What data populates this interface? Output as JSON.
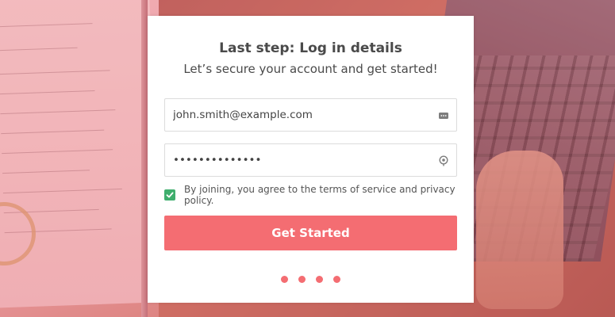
{
  "card": {
    "title": "Last step: Log in details",
    "subtitle": "Let’s secure your account and get started!"
  },
  "email": {
    "value": "john.smith@example.com",
    "icon": "password-manager-icon"
  },
  "password": {
    "value": "••••••••••••••",
    "icon": "password-reveal-icon"
  },
  "terms": {
    "checked": true,
    "prefix": "By joining, you agree to the ",
    "terms_link": "terms of service",
    "middle": " and ",
    "privacy_link": "privacy policy",
    "suffix": "."
  },
  "cta": {
    "label": "Get Started"
  },
  "progress": {
    "steps": 4
  },
  "colors": {
    "accent": "#f46d72",
    "checkbox": "#3fae6d",
    "text": "#4a4a4a"
  }
}
